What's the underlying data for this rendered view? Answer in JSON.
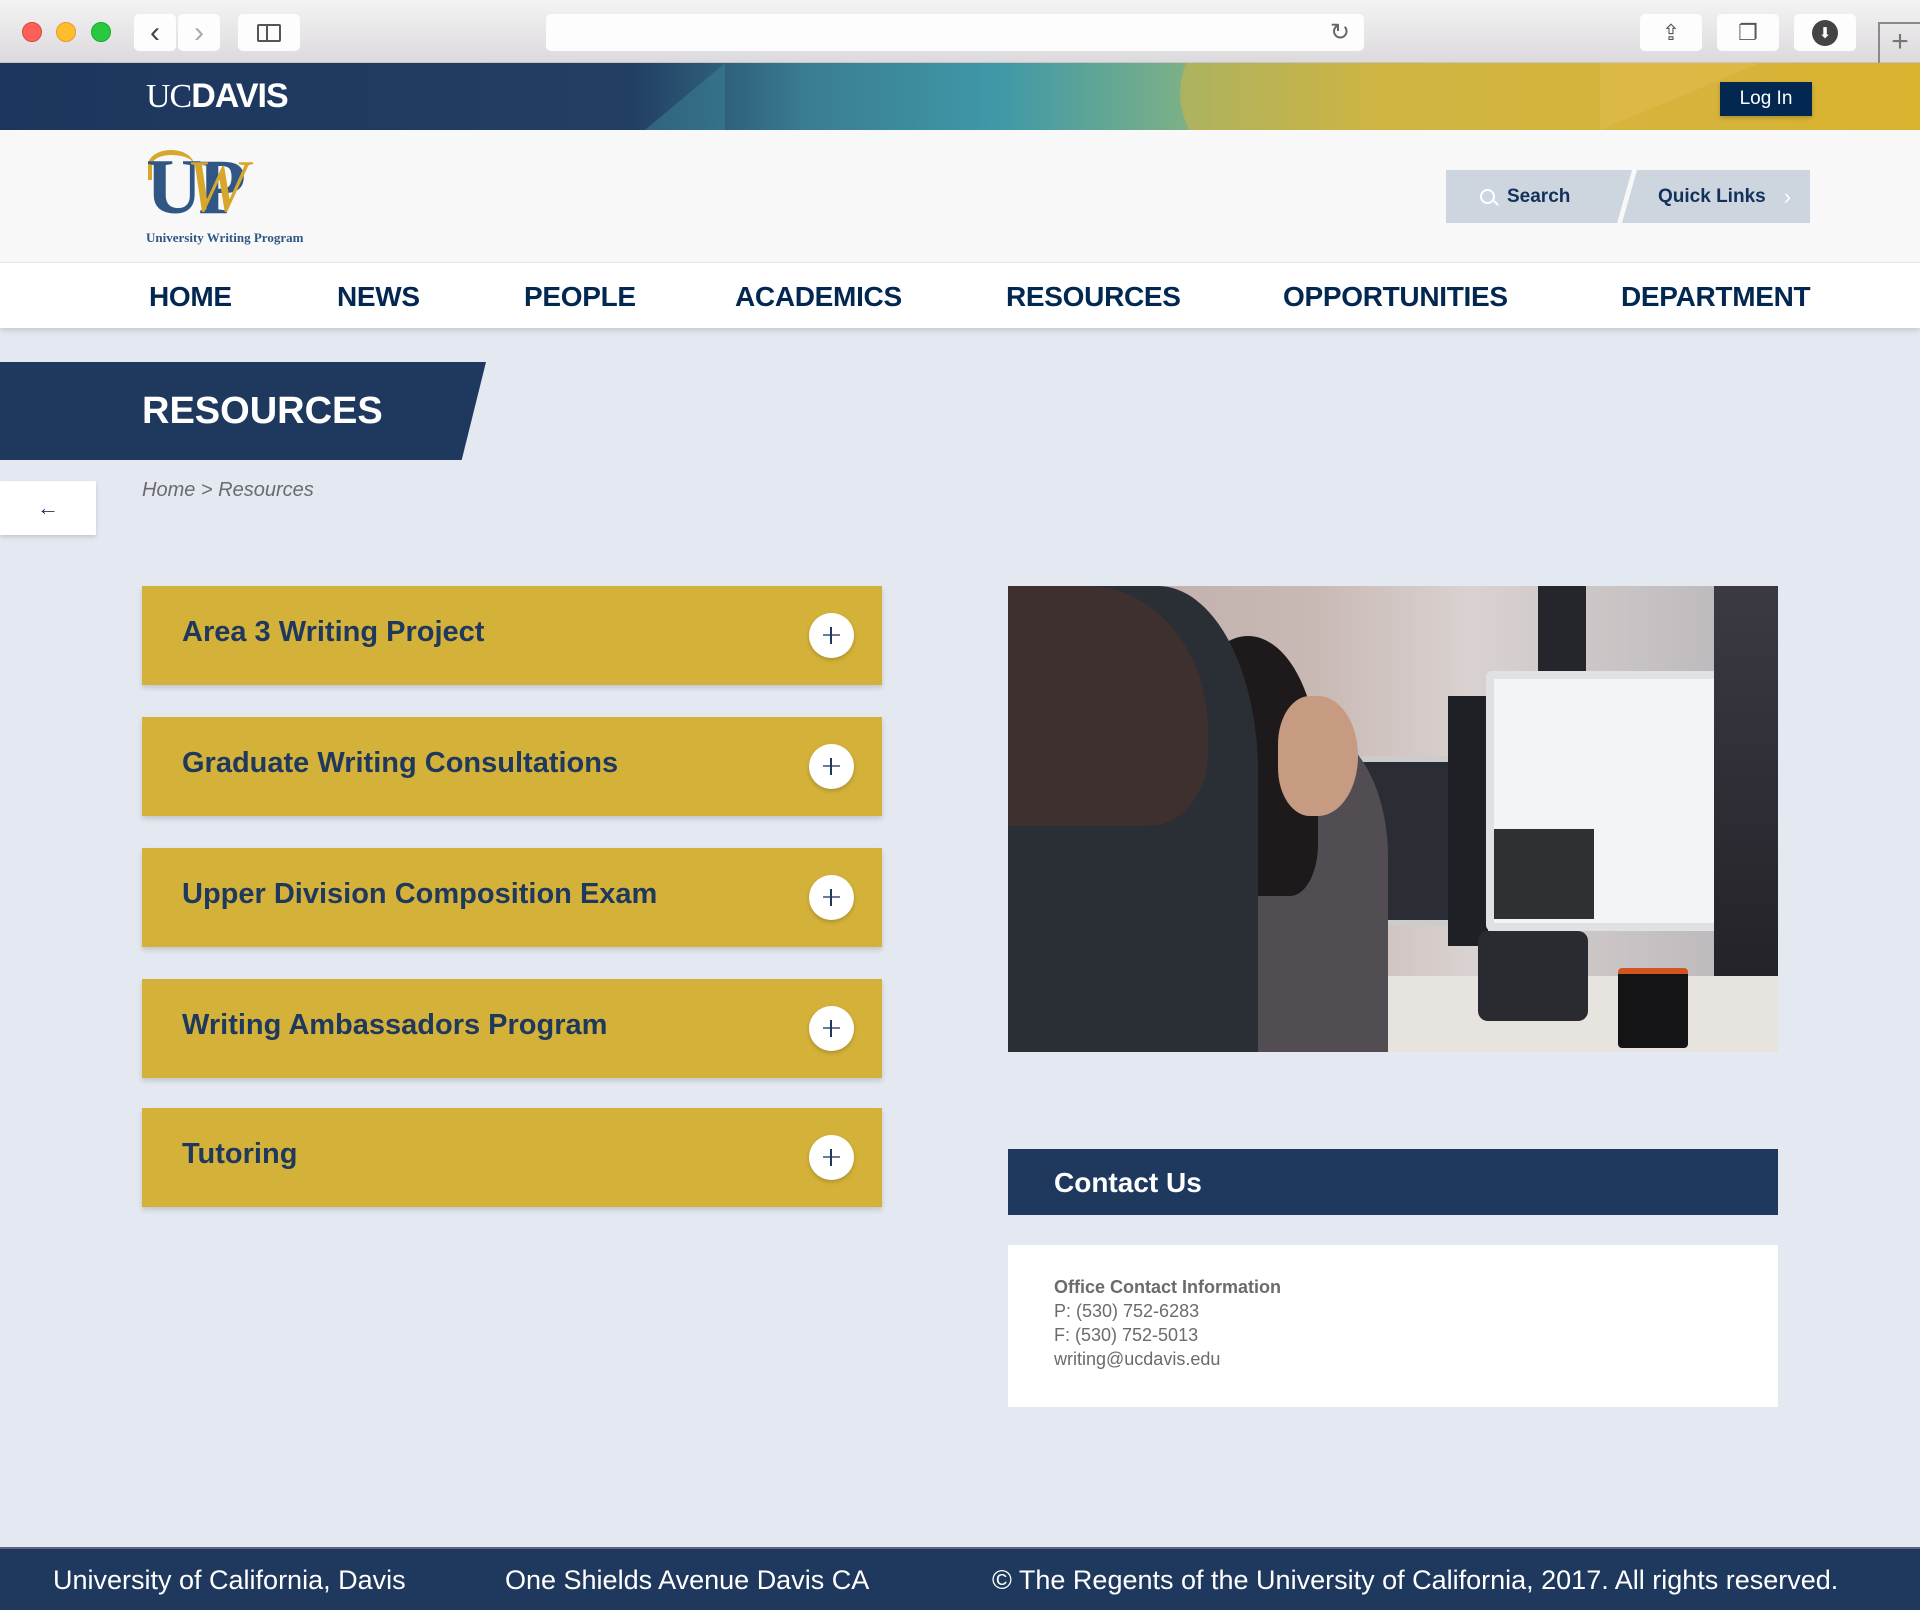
{
  "browser": {
    "address_value": "",
    "controls": {
      "close": "close-window",
      "minimize": "minimize-window",
      "zoom": "zoom-window",
      "back": "back-icon",
      "forward": "forward-icon",
      "sidebar": "sidebar-icon",
      "reload": "reload-icon",
      "share": "share-icon",
      "tabs": "tabs-icon",
      "downloads": "download-icon",
      "new_tab": "plus-icon"
    },
    "glyphs": {
      "back": "‹",
      "forward": "›",
      "reload": "↻",
      "share": "⇪",
      "tabs": "❐",
      "downloads": "⬇",
      "new_tab": "+"
    }
  },
  "topbar": {
    "logo_uc": "UC",
    "logo_davis": "DAVIS",
    "login_label": "Log In"
  },
  "header": {
    "logo_letters": "UP",
    "logo_w": "W",
    "logo_subtitle": "University Writing Program",
    "search_label": "Search",
    "quick_links_label": "Quick Links",
    "quick_links_chevron": "›"
  },
  "nav": {
    "items": [
      {
        "label": "HOME"
      },
      {
        "label": "NEWS"
      },
      {
        "label": "PEOPLE"
      },
      {
        "label": "ACADEMICS"
      },
      {
        "label": "RESOURCES"
      },
      {
        "label": "OPPORTUNITIES"
      },
      {
        "label": "DEPARTMENT"
      }
    ]
  },
  "page": {
    "title": "RESOURCES",
    "back_glyph": "←",
    "breadcrumb": "Home > Resources"
  },
  "accordion": {
    "items": [
      {
        "label": "Area 3 Writing Project",
        "expanded": false
      },
      {
        "label": "Graduate Writing Consultations",
        "expanded": false
      },
      {
        "label": "Upper Division Composition Exam",
        "expanded": false
      },
      {
        "label": "Writing Ambassadors Program",
        "expanded": false
      },
      {
        "label": "Tutoring",
        "expanded": false
      }
    ]
  },
  "photo": {
    "description": "Two women working at computer monitors in an office"
  },
  "contact": {
    "heading": "Contact Us",
    "title": "Office Contact Information",
    "phone": "P: (530) 752-6283",
    "fax": "F: (530) 752-5013",
    "email": "writing@ucdavis.edu"
  },
  "footer": {
    "institution": "University of California, Davis",
    "address": "One Shields Avenue Davis CA",
    "copyright": "© The Regents of the University of California, 2017. All rights reserved."
  },
  "colors": {
    "navy": "#1f385d",
    "dark_navy": "#022851",
    "gold": "#d4b239",
    "page_bg": "#e4e8f0",
    "header_button_bg": "#cdd5df"
  }
}
